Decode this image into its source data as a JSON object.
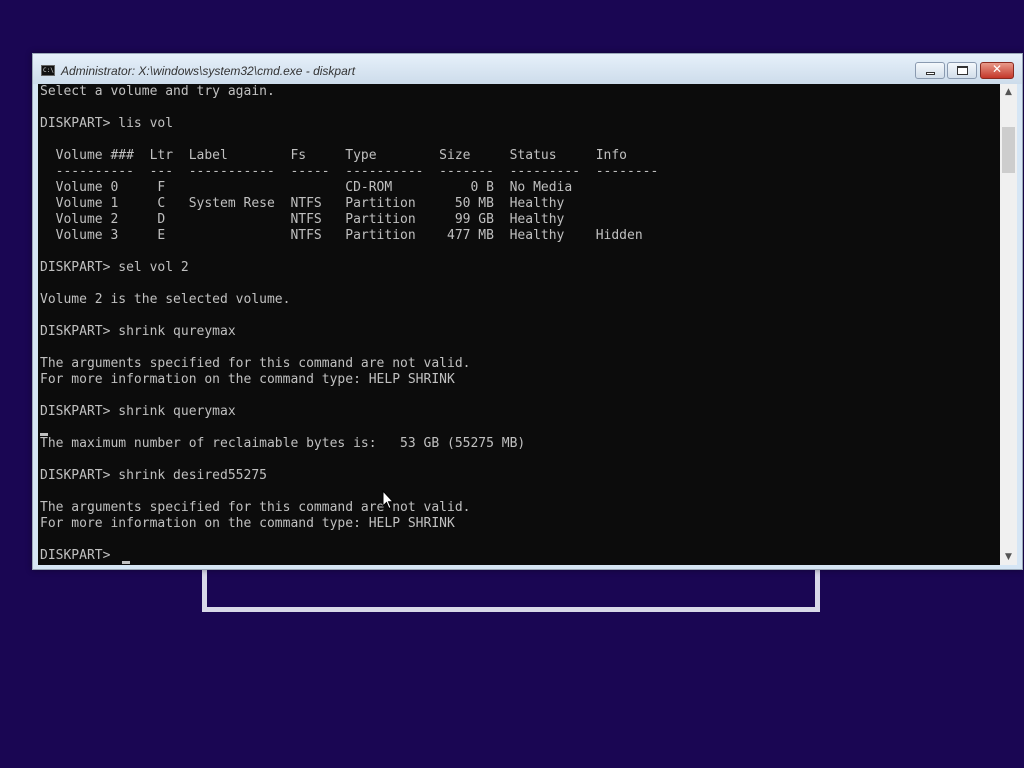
{
  "window": {
    "title": "Administrator: X:\\windows\\system32\\cmd.exe - diskpart",
    "icon_name": "cmd-icon",
    "icon_text": "C:\\",
    "minimize_icon": "minimize-icon",
    "maximize_icon": "maximize-icon",
    "close_icon": "close-icon",
    "close_glyph": "✕"
  },
  "console": {
    "lines": [
      "Select a volume and try again.",
      "",
      "DISKPART> lis vol",
      "",
      "  Volume ###  Ltr  Label        Fs     Type        Size     Status     Info",
      "  ----------  ---  -----------  -----  ----------  -------  ---------  --------",
      "  Volume 0     F                       CD-ROM          0 B  No Media",
      "  Volume 1     C   System Rese  NTFS   Partition     50 MB  Healthy",
      "  Volume 2     D                NTFS   Partition     99 GB  Healthy",
      "  Volume 3     E                NTFS   Partition    477 MB  Healthy    Hidden",
      "",
      "DISKPART> sel vol 2",
      "",
      "Volume 2 is the selected volume.",
      "",
      "DISKPART> shrink qureymax",
      "",
      "The arguments specified for this command are not valid.",
      "For more information on the command type: HELP SHRINK",
      "",
      "DISKPART> shrink querymax",
      "",
      "The maximum number of reclaimable bytes is:   53 GB (55275 MB)",
      "",
      "DISKPART> shrink desired55275",
      "",
      "The arguments specified for this command are not valid.",
      "For more information on the command type: HELP SHRINK",
      "",
      "DISKPART> "
    ]
  },
  "scrollbar": {
    "up_arrow": "▲",
    "down_arrow": "▼"
  },
  "colors": {
    "desktop": "#1a0653",
    "console_bg": "#0c0c0c",
    "console_fg": "#c0c0c0",
    "frame": "#d6e6f5",
    "close_button": "#c4372a"
  }
}
